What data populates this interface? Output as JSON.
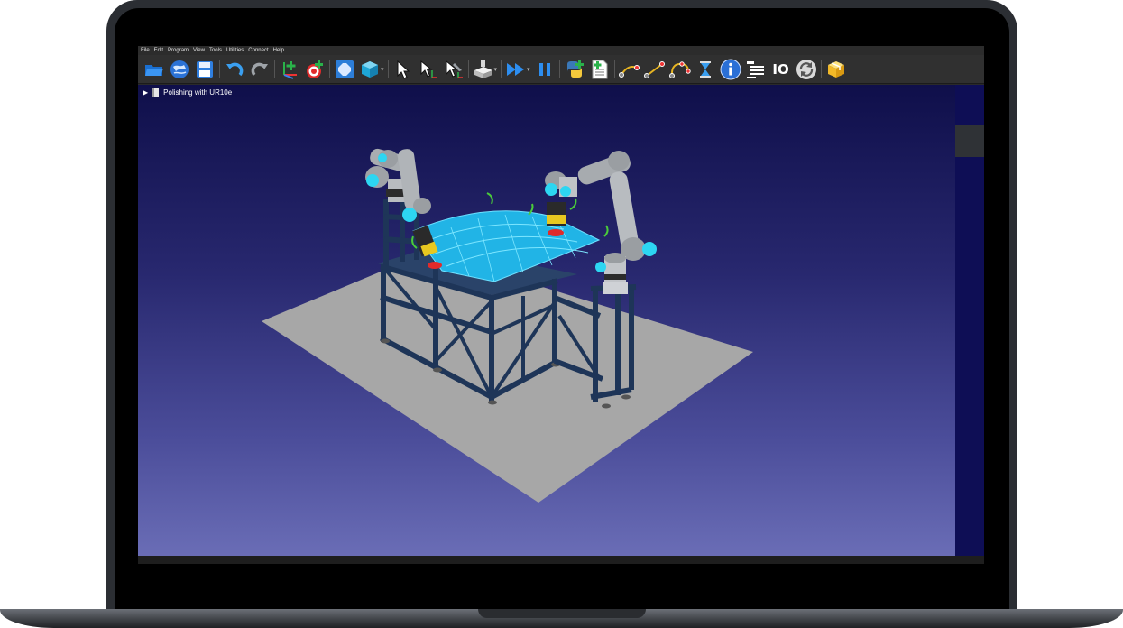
{
  "menu": [
    "File",
    "Edit",
    "Program",
    "View",
    "Tools",
    "Utilities",
    "Connect",
    "Help"
  ],
  "toolbar": {
    "buttons": [
      {
        "icon": "open-station-icon"
      },
      {
        "icon": "library-globe-icon"
      },
      {
        "icon": "save-icon"
      },
      {
        "icon": "undo-icon"
      },
      {
        "icon": "redo-icon"
      },
      {
        "icon": "add-reference-frame-icon"
      },
      {
        "icon": "add-target-icon"
      },
      {
        "icon": "fit-all-icon"
      },
      {
        "icon": "view-cube-icon"
      },
      {
        "icon": "select-pointer-icon"
      },
      {
        "icon": "move-reference-icon"
      },
      {
        "icon": "move-tool-icon"
      },
      {
        "icon": "collision-check-icon"
      },
      {
        "icon": "fast-simulation-icon"
      },
      {
        "icon": "pause-icon"
      },
      {
        "icon": "add-python-program-icon"
      },
      {
        "icon": "add-program-icon"
      },
      {
        "icon": "move-joint-instruction-icon"
      },
      {
        "icon": "move-linear-instruction-icon"
      },
      {
        "icon": "move-circular-instruction-icon"
      },
      {
        "icon": "pause-hourglass-icon"
      },
      {
        "icon": "info-icon"
      },
      {
        "icon": "program-call-icon"
      },
      {
        "icon": "io-icon"
      },
      {
        "icon": "sync-icon"
      },
      {
        "icon": "package-icon"
      }
    ],
    "io_label": "IO"
  },
  "tree": {
    "station_name": "Polishing with UR10e"
  },
  "colors": {
    "accent_cyan": "#19c4e8",
    "ground": "#a3a3a3",
    "frame": "#233a5c",
    "robot_arm": "#b0b4b8"
  }
}
